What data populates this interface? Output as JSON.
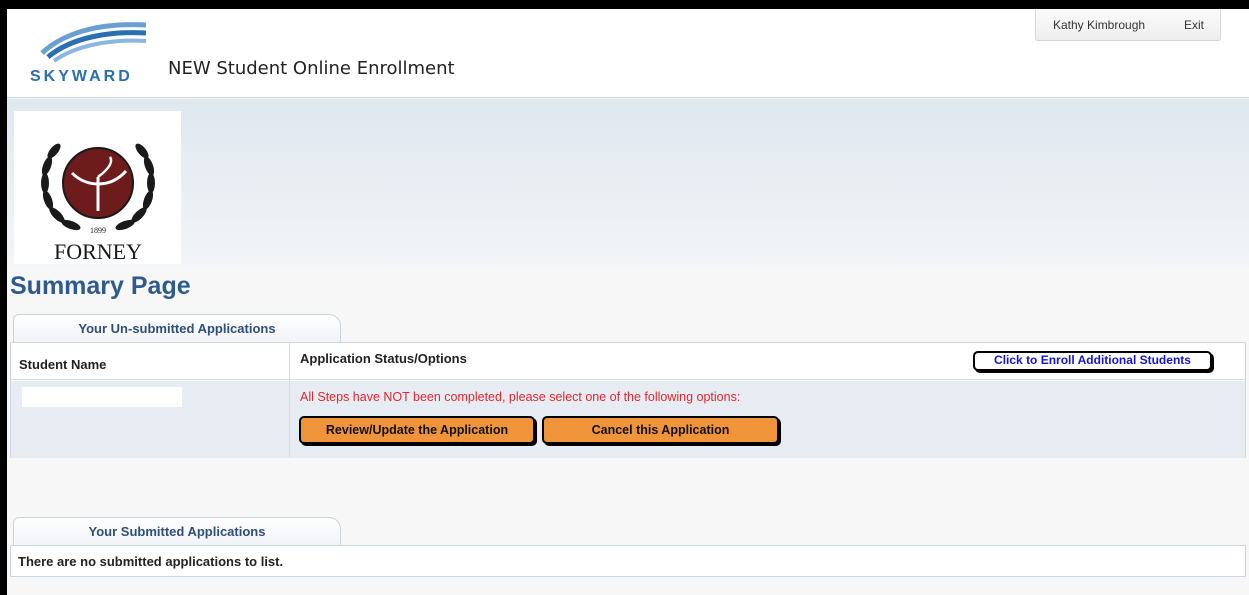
{
  "header": {
    "brand": "SKYWARD",
    "app_title": "NEW Student Online Enrollment",
    "user_name": "Kathy Kimbrough",
    "exit_label": "Exit"
  },
  "district": {
    "name": "FORNEY",
    "seal_text": "INDEPENDENT SCHOOL DISTRICT",
    "seal_year": "1899"
  },
  "page_title": "Summary Page",
  "unsubmitted": {
    "tab_label": "Your Un-submitted Applications",
    "columns": [
      "Student Name",
      "Application Status/Options"
    ],
    "enroll_link": "Click to Enroll Additional Students",
    "rows": [
      {
        "student_name": "",
        "status_message": "All Steps have NOT been completed, please select one of the following options:",
        "actions": [
          "Review/Update the Application",
          "Cancel this Application"
        ]
      }
    ]
  },
  "submitted": {
    "tab_label": "Your Submitted Applications",
    "empty_message": "There are no submitted applications to list."
  },
  "colors": {
    "title_blue": "#2f5a8c",
    "skyward_blue": "#2a6fb0",
    "action_orange": "#f0943a",
    "warning_red": "#e3262d",
    "link_blue": "#1414d6",
    "seal_maroon": "#6e1b1b"
  }
}
